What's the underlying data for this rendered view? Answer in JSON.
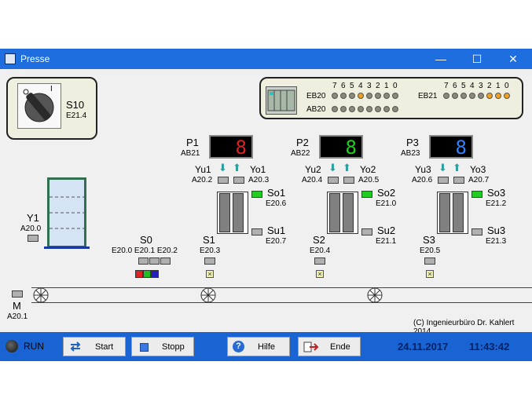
{
  "window": {
    "title": "Presse",
    "min": "—",
    "max": "☐",
    "close": "✕"
  },
  "switch": {
    "name": "S10",
    "addr": "E21.4",
    "pos0": "0",
    "pos1": "I"
  },
  "plc": {
    "bits": [
      "7",
      "6",
      "5",
      "4",
      "3",
      "2",
      "1",
      "0"
    ],
    "eb20": "EB20",
    "ab20": "AB20",
    "eb21": "EB21",
    "eb20_leds": [
      0,
      0,
      0,
      1,
      0,
      0,
      0,
      0
    ],
    "ab20_leds": [
      0,
      0,
      0,
      0,
      0,
      0,
      0,
      0
    ],
    "eb21_leds": [
      0,
      0,
      0,
      0,
      0,
      1,
      1,
      1
    ]
  },
  "stations": [
    {
      "p": "P1",
      "ab": "AB21",
      "digit": "8",
      "digit_color": "#e02020",
      "yu": "Yu1",
      "yo": "Yo1",
      "yu_addr": "A20.2",
      "yo_addr": "A20.3",
      "so": "So1",
      "so_addr": "E20.6",
      "su": "Su1",
      "su_addr": "E20.7",
      "s": "S1",
      "s_addr": "E20.3"
    },
    {
      "p": "P2",
      "ab": "AB22",
      "digit": "8",
      "digit_color": "#20d020",
      "yu": "Yu2",
      "yo": "Yo2",
      "yu_addr": "A20.4",
      "yo_addr": "A20.5",
      "so": "So2",
      "so_addr": "E21.0",
      "su": "Su2",
      "su_addr": "E21.1",
      "s": "S2",
      "s_addr": "E20.4"
    },
    {
      "p": "P3",
      "ab": "AB23",
      "digit": "8",
      "digit_color": "#3080ff",
      "yu": "Yu3",
      "yo": "Yo3",
      "yu_addr": "A20.6",
      "yo_addr": "A20.7",
      "so": "So3",
      "so_addr": "E21.2",
      "su": "Su3",
      "su_addr": "E21.3",
      "s": "S3",
      "s_addr": "E20.5"
    }
  ],
  "y1": {
    "name": "Y1",
    "addr": "A20.0"
  },
  "s0": {
    "name": "S0",
    "addr": "E20.0 E20.1 E20.2"
  },
  "motor": {
    "name": "M",
    "addr": "A20.1"
  },
  "copyright": "(C) Ingenieurbüro Dr. Kahlert 2014",
  "status": {
    "run": "RUN"
  },
  "buttons": {
    "start": "Start",
    "stop": "Stopp",
    "help": "Hilfe",
    "end": "Ende"
  },
  "date": "24.11.2017",
  "time": "11:43:42",
  "colors": {
    "titlebar": "#1e6ee0",
    "bottombar": "#1964d2",
    "datetime": "#002266",
    "led_on": "#f0a020",
    "green_sensor": "#22cc22"
  }
}
